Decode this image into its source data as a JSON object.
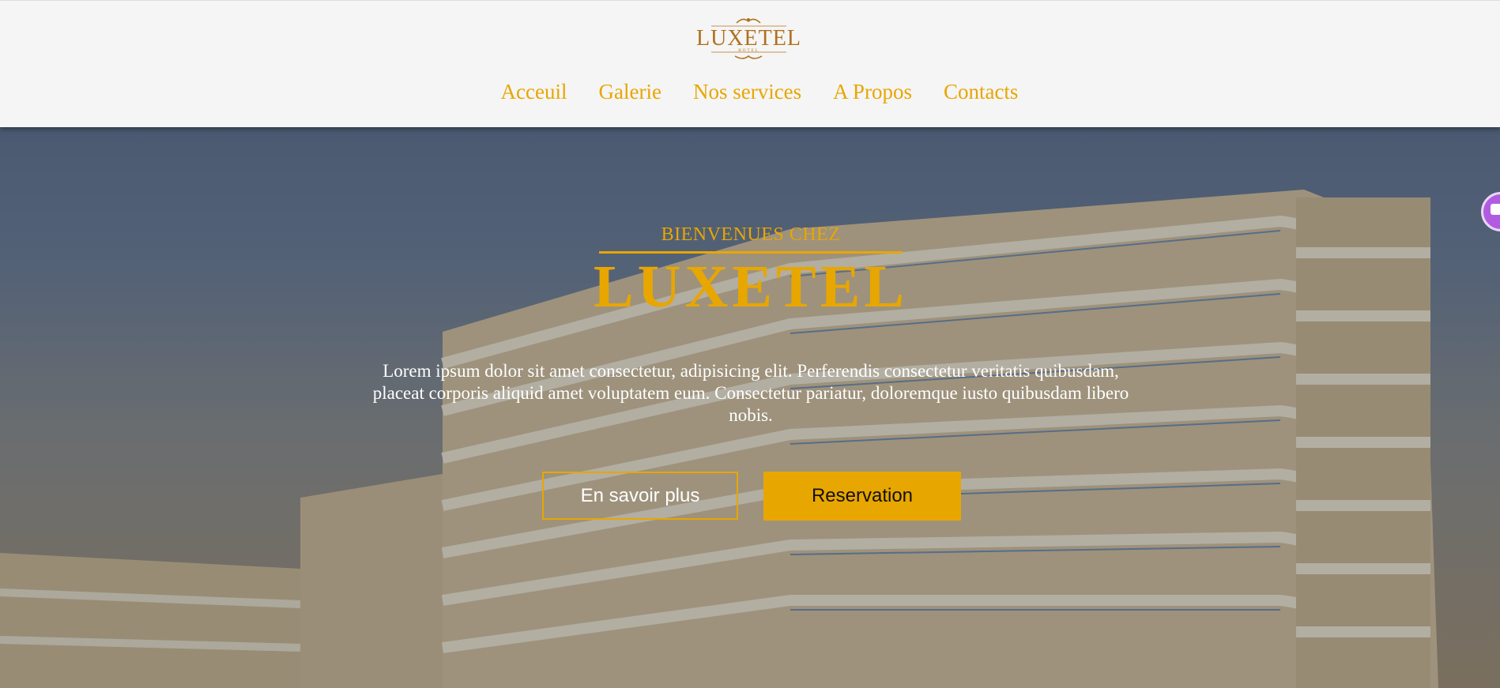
{
  "header": {
    "logo_text": "LUXETEL",
    "logo_sub": "HOTEL",
    "nav": [
      "Acceuil",
      "Galerie",
      "Nos services",
      "A Propos",
      "Contacts"
    ]
  },
  "hero": {
    "welcome": "BIENVENUES CHEZ",
    "brand": "LUXETEL",
    "description": "Lorem ipsum dolor sit amet consectetur, adipisicing elit. Perferendis consectetur veritatis quibusdam, placeat corporis aliquid amet voluptatem eum. Consectetur pariatur, doloremque iusto quibusdam libero nobis.",
    "btn_more": "En savoir plus",
    "btn_reserve": "Reservation"
  },
  "colors": {
    "accent": "#e8a600",
    "logo": "#b0701e",
    "chat": "#b15ce0"
  },
  "icons": {
    "chat_widget": "chat-bubble-icon"
  }
}
